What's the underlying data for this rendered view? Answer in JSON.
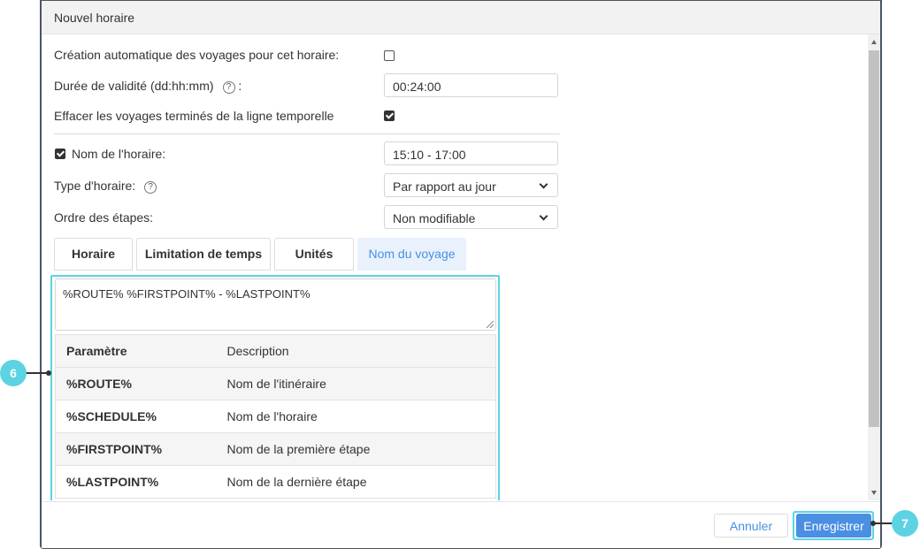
{
  "dialog": {
    "title": "Nouvel horaire"
  },
  "form": {
    "auto_create_label": "Création automatique des voyages pour cet horaire:",
    "auto_create_checked": false,
    "validity_label": "Durée de validité (dd:hh:mm)",
    "validity_suffix": ":",
    "validity_value": "00:24:00",
    "clear_trips_label": "Effacer les voyages terminés de la ligne temporelle",
    "clear_trips_checked": true,
    "schedule_name_label": "Nom de l'horaire:",
    "schedule_name_checked": true,
    "schedule_name_value": "15:10 - 17:00",
    "schedule_type_label": "Type d'horaire:",
    "schedule_type_value": "Par rapport au jour",
    "stage_order_label": "Ordre des étapes:",
    "stage_order_value": "Non modifiable",
    "help_glyph": "?"
  },
  "tabs": [
    {
      "label": "Horaire",
      "active": false
    },
    {
      "label": "Limitation de temps",
      "active": false
    },
    {
      "label": "Unités",
      "active": false
    },
    {
      "label": "Nom du voyage",
      "active": true
    }
  ],
  "trip_name": {
    "template": "%ROUTE% %FIRSTPOINT% - %LASTPOINT%",
    "headers": {
      "param": "Paramètre",
      "desc": "Description"
    },
    "rows": [
      {
        "param": "%ROUTE%",
        "desc": "Nom de l'itinéraire"
      },
      {
        "param": "%SCHEDULE%",
        "desc": "Nom de l'horaire"
      },
      {
        "param": "%FIRSTPOINT%",
        "desc": "Nom de la première étape"
      },
      {
        "param": "%LASTPOINT%",
        "desc": "Nom de la dernière étape"
      }
    ]
  },
  "footer": {
    "cancel_label": "Annuler",
    "save_label": "Enregistrer"
  },
  "callouts": {
    "c6": "6",
    "c7": "7"
  },
  "colors": {
    "accent": "#4a8fe2",
    "highlight": "#5cd3e3",
    "border": "#4a5563"
  }
}
